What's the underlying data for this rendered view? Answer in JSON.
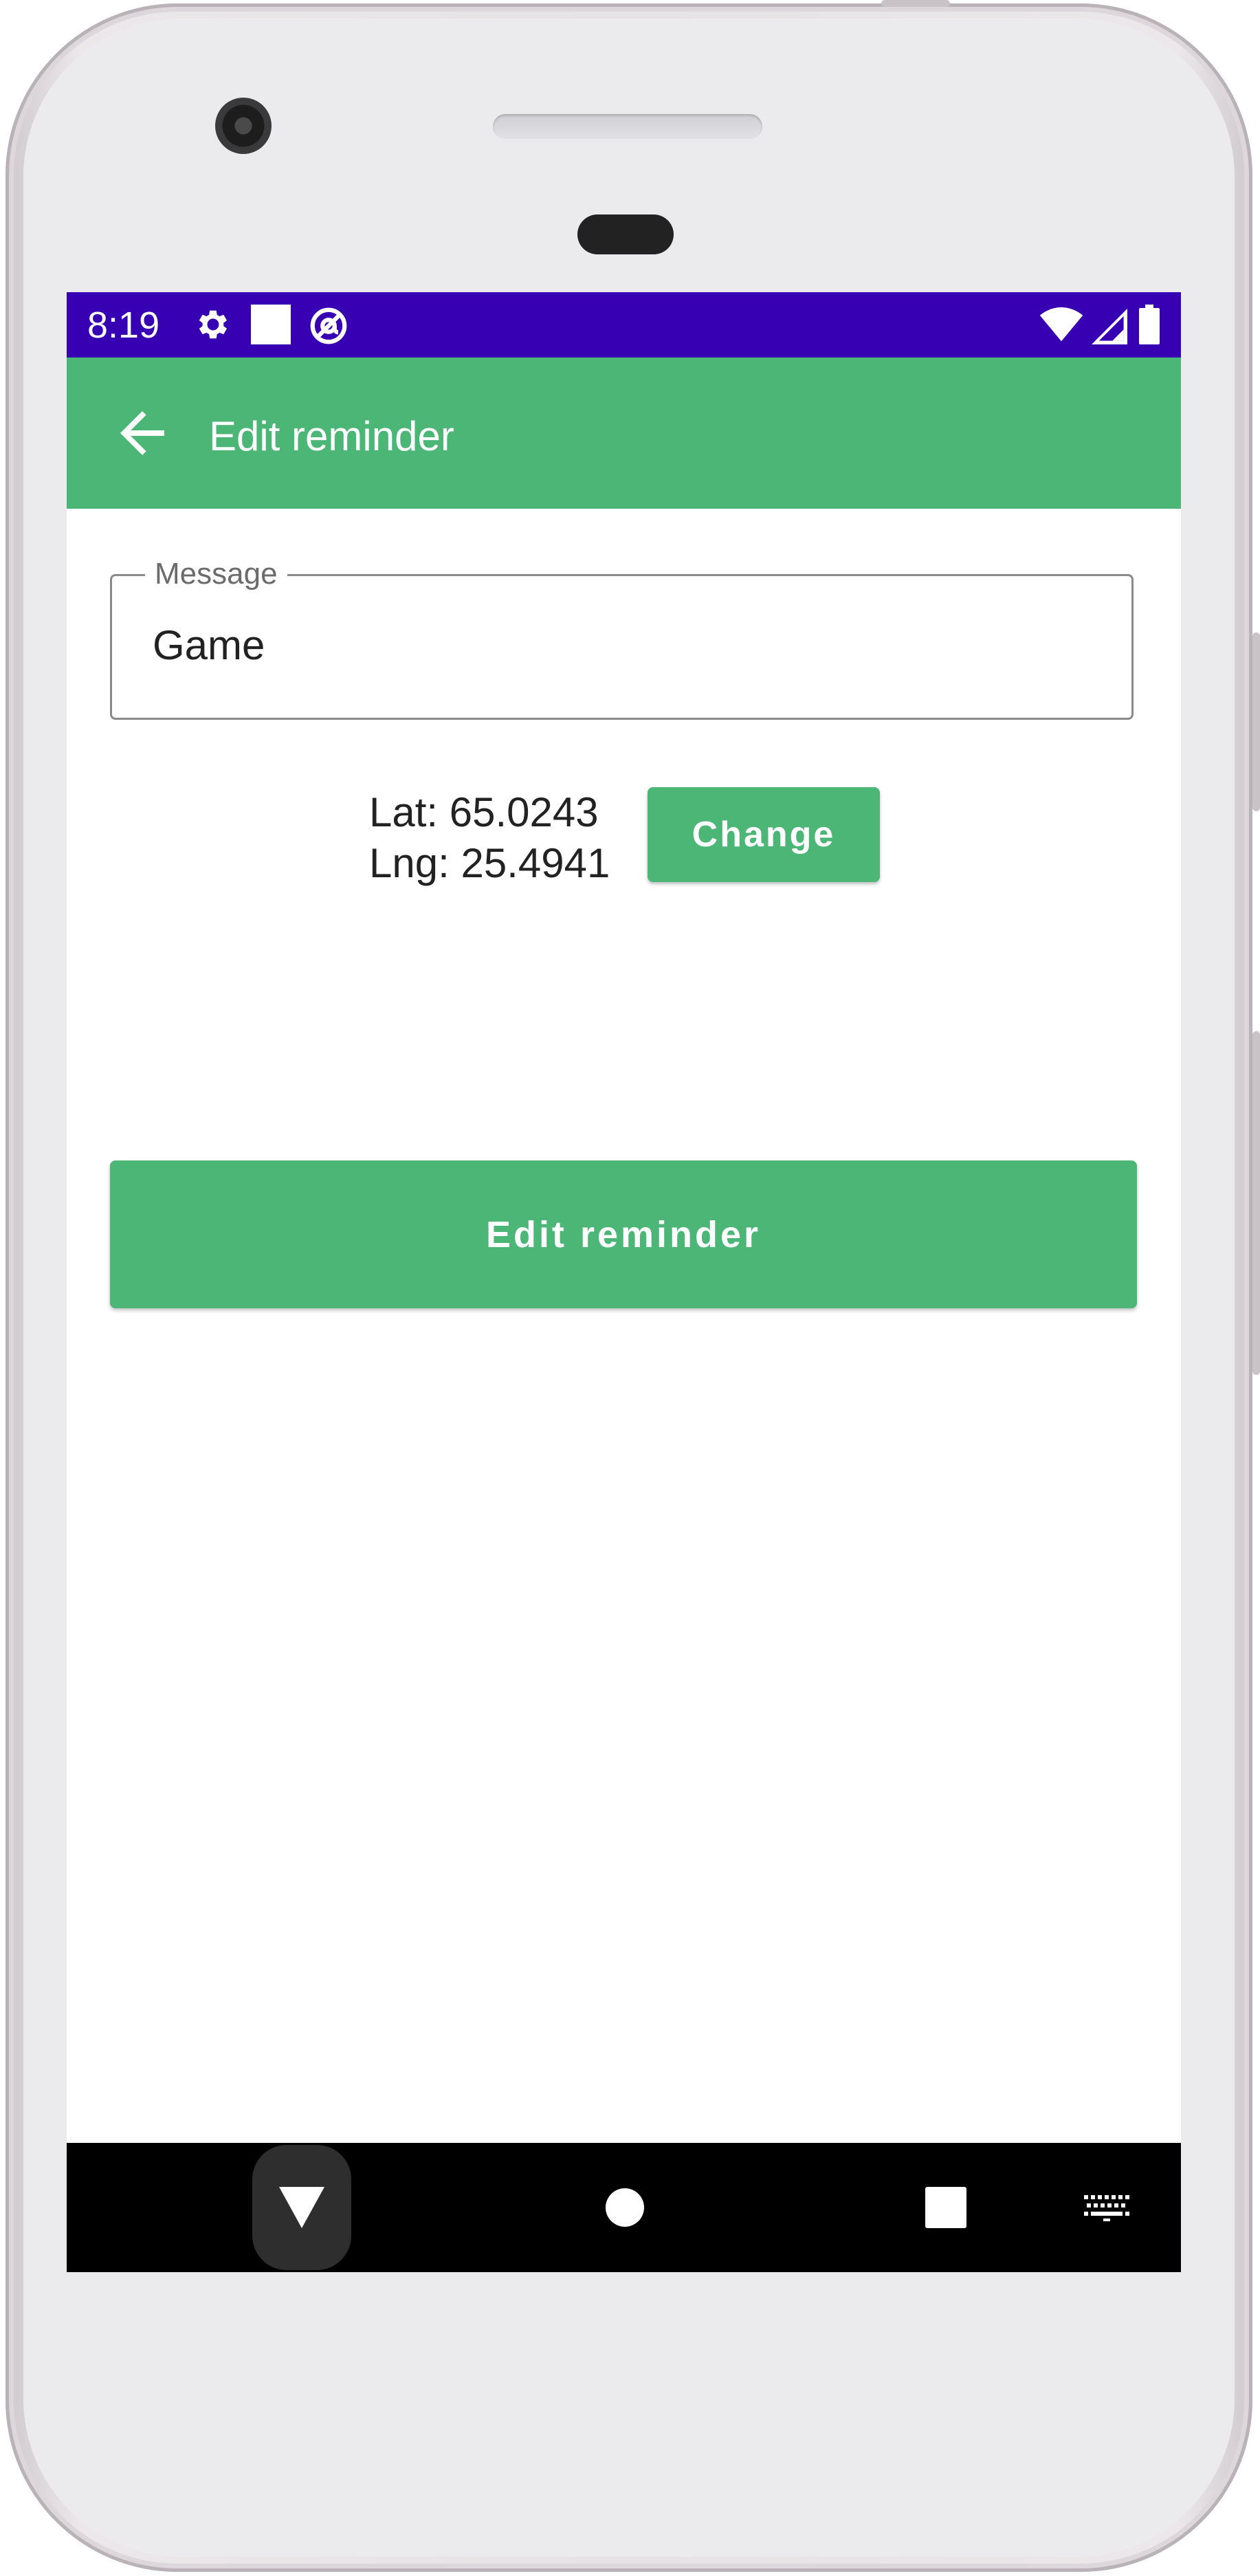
{
  "status_bar": {
    "time": "8:19",
    "left_icons": [
      "gear-icon",
      "square-notification-icon",
      "at-circle-icon"
    ],
    "right_icons": [
      "wifi-icon",
      "signal-icon",
      "battery-icon"
    ],
    "color": "#3700b3"
  },
  "app_bar": {
    "title": "Edit reminder",
    "back_icon": "arrow-left-icon",
    "color": "#4cb677"
  },
  "form": {
    "message_label": "Message",
    "message_value": "Game",
    "lat_text": "Lat: 65.0243",
    "lng_text": "Lng: 25.4941",
    "change_label": "Change",
    "submit_label": "Edit reminder"
  },
  "nav_bar": {
    "icons": [
      "nav-back-icon",
      "nav-home-icon",
      "nav-recents-icon",
      "keyboard-icon"
    ]
  },
  "colors": {
    "accent": "#4cb677",
    "status": "#3700b3"
  }
}
